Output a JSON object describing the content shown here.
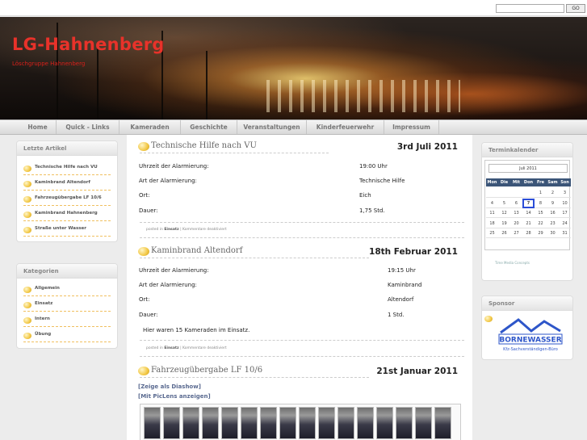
{
  "search": {
    "placeholder": "",
    "button": "GO"
  },
  "header": {
    "title": "LG-Hahnenberg",
    "tagline": "Löschgruppe Hahnenberg"
  },
  "nav": [
    "Home",
    "Quick - Links",
    "Kameraden",
    "Geschichte",
    "Veranstaltungen",
    "Kinderfeuerwehr",
    "Impressum"
  ],
  "left": {
    "recent_title": "Letzte Artikel",
    "recent": [
      "Technische Hilfe nach VU",
      "Kaminbrand Altendorf",
      "Fahrzeugübergabe LF 10/6",
      "Kaminbrand Hahnenberg",
      "Straße unter Wasser"
    ],
    "categories_title": "Kategorien",
    "categories": [
      "Allgemein",
      "Einsatz",
      "Intern",
      "Übung"
    ]
  },
  "posts": [
    {
      "title": "Technische Hilfe nach VU",
      "date": "3rd Juli 2011",
      "rows": [
        [
          "Uhrzeit der Alarmierung:",
          "19:00 Uhr"
        ],
        [
          "Art der Alarmierung:",
          "Technische Hilfe"
        ],
        [
          "Ort:",
          "Eich"
        ],
        [
          "Dauer:",
          "1,75 Std."
        ]
      ],
      "meta_prefix": "posted in",
      "meta_category": "Einsatz",
      "meta_suffix": "| Kommentare deaktiviert"
    },
    {
      "title": "Kaminbrand Altendorf",
      "date": "18th Februar 2011",
      "rows": [
        [
          "Uhrzeit der Alarmierung:",
          "19:15 Uhr"
        ],
        [
          "Art der Alarmierung:",
          "Kaminbrand"
        ],
        [
          "Ort:",
          "Altendorf"
        ],
        [
          "Dauer:",
          "1 Std."
        ]
      ],
      "text": "Hier waren 15 Kameraden im Einsatz.",
      "meta_prefix": "posted in",
      "meta_category": "Einsatz",
      "meta_suffix": "| Kommentare deaktiviert"
    },
    {
      "title": "Fahrzeugübergabe LF 10/6",
      "date": "21st Januar 2011",
      "links": [
        "[Zeige als Diashow]",
        "[Mit PicLens anzeigen]"
      ]
    }
  ],
  "right": {
    "calendar_title": "Terminkalender",
    "month": "Juli 2011",
    "dow": [
      "Mon",
      "Die",
      "Mit",
      "Don",
      "Fre",
      "Sam",
      "Son"
    ],
    "weeks": [
      [
        "",
        "",
        "",
        "",
        "1",
        "2",
        "3"
      ],
      [
        "4",
        "5",
        "6",
        "7",
        "8",
        "9",
        "10"
      ],
      [
        "11",
        "12",
        "13",
        "14",
        "15",
        "16",
        "17"
      ],
      [
        "18",
        "19",
        "20",
        "21",
        "22",
        "23",
        "24"
      ],
      [
        "25",
        "26",
        "27",
        "28",
        "29",
        "30",
        "31"
      ]
    ],
    "today": "7",
    "credit": "Time Media Concepts",
    "sponsor_title": "Sponsor",
    "sponsor_name": "BORNEWASSER",
    "sponsor_sub": "Kfz-Sachverständigen-Büro"
  },
  "colors": {
    "title": "#e8322a",
    "bullet": "#f2c744",
    "calendar_head": "#3b5578"
  }
}
